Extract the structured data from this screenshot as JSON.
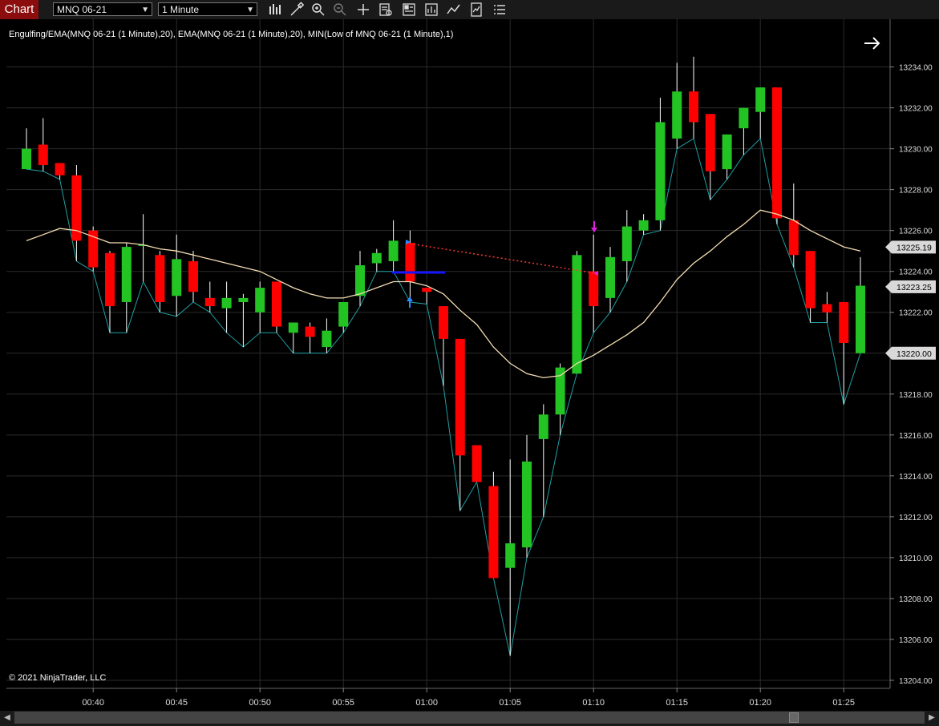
{
  "app": {
    "title": "Chart"
  },
  "toolbar": {
    "instrument": "MNQ 06-21",
    "interval": "1 Minute",
    "icons": [
      "bar-type-icon",
      "draw-tools-icon",
      "zoom-in-icon",
      "zoom-out-icon",
      "crosshair-icon",
      "data-box-icon",
      "properties-icon",
      "strategies-icon",
      "indicators-icon",
      "templates-icon",
      "more-icon"
    ]
  },
  "chart_data": {
    "type": "candlestick",
    "title": "Engulfing/EMA(MNQ 06-21 (1 Minute),20), EMA(MNQ 06-21 (1 Minute),20), MIN(Low of MNQ 06-21 (1 Minute),1)",
    "copyright": "© 2021 NinjaTrader, LLC",
    "ylim": [
      13203.0,
      13238.0
    ],
    "yticks": [
      13204,
      13206,
      13208,
      13210,
      13212,
      13214,
      13216,
      13218,
      13220,
      13222,
      13224,
      13226,
      13228,
      13230,
      13232,
      13234
    ],
    "x_ticks": [
      {
        "label": "00:40",
        "bar": 4
      },
      {
        "label": "00:45",
        "bar": 9
      },
      {
        "label": "00:50",
        "bar": 14
      },
      {
        "label": "00:55",
        "bar": 19
      },
      {
        "label": "01:00",
        "bar": 24
      },
      {
        "label": "01:05",
        "bar": 29
      },
      {
        "label": "01:10",
        "bar": 34
      },
      {
        "label": "01:15",
        "bar": 39
      },
      {
        "label": "01:20",
        "bar": 44
      },
      {
        "label": "01:25",
        "bar": 49
      }
    ],
    "price_markers": [
      {
        "value": 13225.19,
        "label": "13225.19"
      },
      {
        "value": 13223.25,
        "label": "13223.25"
      },
      {
        "value": 13220.0,
        "label": "13220.00"
      }
    ],
    "colors": {
      "up": "#22c322",
      "down": "#ff0000",
      "ema": "#f5deb3",
      "min": "#1f9fa3",
      "grid": "#2b2b2b"
    },
    "candles": [
      {
        "o": 13229.0,
        "h": 13231.0,
        "l": 13229.0,
        "c": 13230.0
      },
      {
        "o": 13230.2,
        "h": 13231.5,
        "l": 13228.9,
        "c": 13229.2
      },
      {
        "o": 13229.3,
        "h": 13229.3,
        "l": 13228.5,
        "c": 13228.7
      },
      {
        "o": 13228.7,
        "h": 13229.2,
        "l": 13224.5,
        "c": 13225.5
      },
      {
        "o": 13226.0,
        "h": 13226.2,
        "l": 13224.0,
        "c": 13224.2
      },
      {
        "o": 13224.9,
        "h": 13225.0,
        "l": 13221.0,
        "c": 13222.3
      },
      {
        "o": 13222.5,
        "h": 13225.4,
        "l": 13221.0,
        "c": 13225.2
      },
      {
        "o": 13225.3,
        "h": 13226.8,
        "l": 13223.5,
        "c": 13225.3
      },
      {
        "o": 13224.8,
        "h": 13225.0,
        "l": 13222.0,
        "c": 13222.5
      },
      {
        "o": 13222.8,
        "h": 13225.8,
        "l": 13221.8,
        "c": 13224.6
      },
      {
        "o": 13224.5,
        "h": 13225.0,
        "l": 13222.5,
        "c": 13223.0
      },
      {
        "o": 13222.7,
        "h": 13223.5,
        "l": 13222.0,
        "c": 13222.3
      },
      {
        "o": 13222.2,
        "h": 13223.5,
        "l": 13221.0,
        "c": 13222.7
      },
      {
        "o": 13222.5,
        "h": 13222.9,
        "l": 13220.3,
        "c": 13222.7
      },
      {
        "o": 13222.0,
        "h": 13223.5,
        "l": 13221.0,
        "c": 13223.2
      },
      {
        "o": 13223.5,
        "h": 13223.5,
        "l": 13221.0,
        "c": 13221.3
      },
      {
        "o": 13221.0,
        "h": 13221.5,
        "l": 13220.0,
        "c": 13221.5
      },
      {
        "o": 13221.3,
        "h": 13221.5,
        "l": 13220.0,
        "c": 13220.8
      },
      {
        "o": 13220.3,
        "h": 13221.7,
        "l": 13220.0,
        "c": 13221.1
      },
      {
        "o": 13221.3,
        "h": 13222.5,
        "l": 13221.0,
        "c": 13222.5
      },
      {
        "o": 13222.8,
        "h": 13225.0,
        "l": 13222.3,
        "c": 13224.3
      },
      {
        "o": 13224.4,
        "h": 13225.1,
        "l": 13224.0,
        "c": 13224.9
      },
      {
        "o": 13224.5,
        "h": 13226.5,
        "l": 13224.0,
        "c": 13225.5
      },
      {
        "o": 13225.4,
        "h": 13226.0,
        "l": 13222.5,
        "c": 13223.5
      },
      {
        "o": 13223.2,
        "h": 13223.2,
        "l": 13222.4,
        "c": 13223.0
      },
      {
        "o": 13222.3,
        "h": 13222.3,
        "l": 13218.4,
        "c": 13220.7
      },
      {
        "o": 13220.7,
        "h": 13220.7,
        "l": 13212.3,
        "c": 13215.0
      },
      {
        "o": 13215.5,
        "h": 13215.5,
        "l": 13213.7,
        "c": 13213.7
      },
      {
        "o": 13213.5,
        "h": 13214.2,
        "l": 13209.0,
        "c": 13209.0
      },
      {
        "o": 13209.5,
        "h": 13214.8,
        "l": 13205.2,
        "c": 13210.7
      },
      {
        "o": 13210.5,
        "h": 13216.0,
        "l": 13210.0,
        "c": 13214.7
      },
      {
        "o": 13215.8,
        "h": 13217.5,
        "l": 13212.0,
        "c": 13217.0
      },
      {
        "o": 13217.0,
        "h": 13219.5,
        "l": 13216.0,
        "c": 13219.3
      },
      {
        "o": 13219.0,
        "h": 13225.0,
        "l": 13219.0,
        "c": 13224.8
      },
      {
        "o": 13224.0,
        "h": 13225.8,
        "l": 13221.0,
        "c": 13222.3
      },
      {
        "o": 13222.7,
        "h": 13225.2,
        "l": 13222.0,
        "c": 13224.7
      },
      {
        "o": 13224.5,
        "h": 13227.0,
        "l": 13223.5,
        "c": 13226.2
      },
      {
        "o": 13226.0,
        "h": 13226.8,
        "l": 13225.8,
        "c": 13226.5
      },
      {
        "o": 13226.5,
        "h": 13232.5,
        "l": 13226.0,
        "c": 13231.3
      },
      {
        "o": 13230.5,
        "h": 13234.2,
        "l": 13230.0,
        "c": 13232.8
      },
      {
        "o": 13232.8,
        "h": 13234.5,
        "l": 13230.5,
        "c": 13231.3
      },
      {
        "o": 13231.7,
        "h": 13231.7,
        "l": 13227.5,
        "c": 13228.9
      },
      {
        "o": 13229.0,
        "h": 13230.7,
        "l": 13228.5,
        "c": 13230.7
      },
      {
        "o": 13231.0,
        "h": 13232.0,
        "l": 13229.7,
        "c": 13232.0
      },
      {
        "o": 13231.8,
        "h": 13233.0,
        "l": 13230.5,
        "c": 13233.0
      },
      {
        "o": 13233.0,
        "h": 13233.0,
        "l": 13226.3,
        "c": 13226.6
      },
      {
        "o": 13226.5,
        "h": 13228.3,
        "l": 13224.2,
        "c": 13224.8
      },
      {
        "o": 13225.0,
        "h": 13225.0,
        "l": 13221.5,
        "c": 13222.2
      },
      {
        "o": 13222.4,
        "h": 13223.0,
        "l": 13221.5,
        "c": 13222.0
      },
      {
        "o": 13222.5,
        "h": 13222.5,
        "l": 13217.5,
        "c": 13220.5
      },
      {
        "o": 13220.0,
        "h": 13224.7,
        "l": 13220.0,
        "c": 13223.3
      }
    ],
    "ema": [
      13225.5,
      13225.8,
      13226.1,
      13226.0,
      13225.7,
      13225.4,
      13225.4,
      13225.3,
      13225.1,
      13225.0,
      13224.8,
      13224.6,
      13224.4,
      13224.2,
      13224.0,
      13223.6,
      13223.2,
      13222.9,
      13222.7,
      13222.7,
      13222.9,
      13223.2,
      13223.5,
      13223.5,
      13223.3,
      13222.9,
      13222.1,
      13221.4,
      13220.3,
      13219.5,
      13219.0,
      13218.8,
      13218.9,
      13219.5,
      13219.9,
      13220.4,
      13220.9,
      13221.5,
      13222.5,
      13223.6,
      13224.4,
      13225.0,
      13225.7,
      13226.3,
      13227.0,
      13226.8,
      13226.5,
      13226.0,
      13225.6,
      13225.2,
      13225.0
    ]
  }
}
